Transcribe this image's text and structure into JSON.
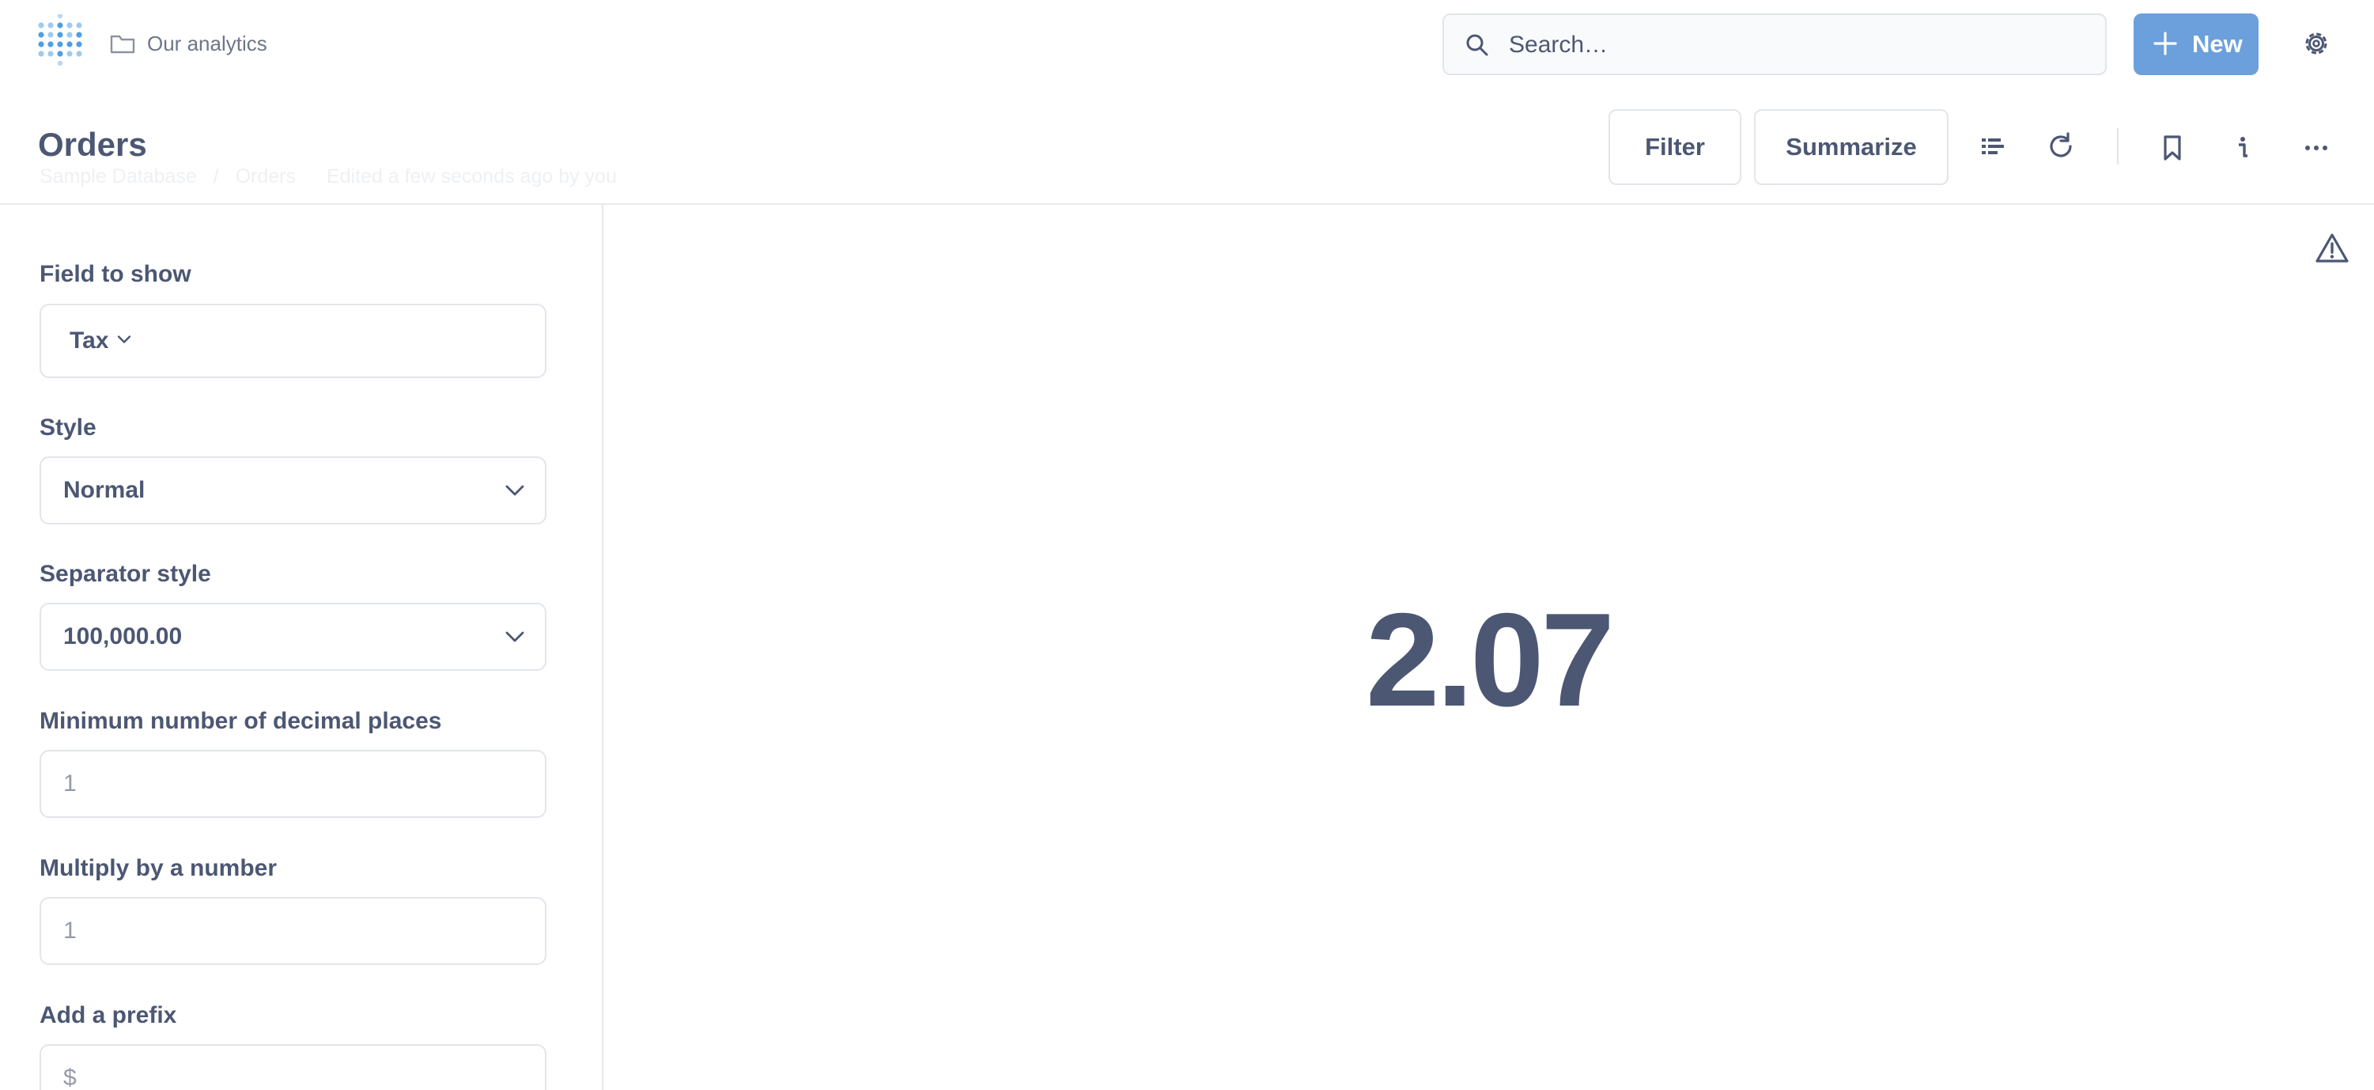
{
  "nav": {
    "collection": "Our analytics",
    "search_placeholder": "Search…",
    "new_label": "New"
  },
  "header": {
    "title": "Orders",
    "breadcrumbs": [
      "Sample Database",
      "/",
      "Orders"
    ],
    "edited": "Edited a few seconds ago by you",
    "filter_label": "Filter",
    "summarize_label": "Summarize"
  },
  "sidebar": {
    "field_to_show": {
      "label": "Field to show",
      "value": "Tax"
    },
    "style": {
      "label": "Style",
      "value": "Normal"
    },
    "separator": {
      "label": "Separator style",
      "value": "100,000.00"
    },
    "min_decimals": {
      "label": "Minimum number of decimal places",
      "placeholder": "1"
    },
    "multiply": {
      "label": "Multiply by a number",
      "placeholder": "1"
    },
    "prefix": {
      "label": "Add a prefix",
      "placeholder": "$"
    }
  },
  "main": {
    "value": "2.07"
  },
  "colors": {
    "brand": "#509ee3",
    "new_button": "#6ba0dc",
    "text": "#4c5773",
    "border": "#e2e5ea"
  },
  "icons": [
    "logo-icon",
    "folder-icon",
    "search-icon",
    "plus-icon",
    "gear-icon",
    "notebook-icon",
    "refresh-icon",
    "bookmark-icon",
    "info-icon",
    "more-icon",
    "chevron-down-icon",
    "warning-icon"
  ]
}
